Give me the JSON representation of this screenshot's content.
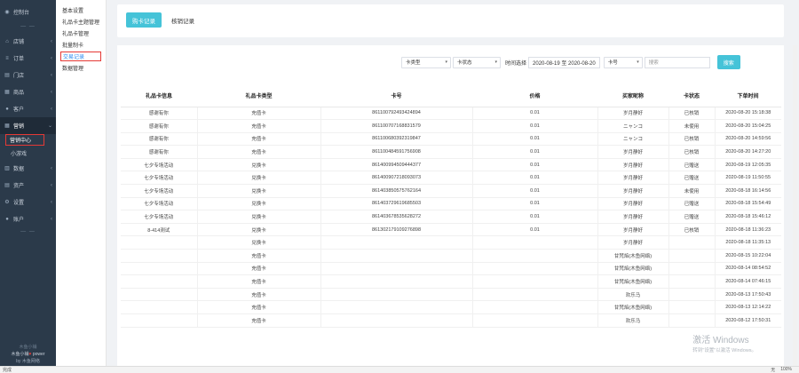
{
  "sidebar": {
    "items": [
      {
        "label": "控制台",
        "icon": "dashboard-icon",
        "glyph": "◉",
        "arrow": ""
      },
      {
        "label": "店铺",
        "icon": "home-icon",
        "glyph": "⌂",
        "arrow": "‹"
      },
      {
        "label": "订单",
        "icon": "list-icon",
        "glyph": "≡",
        "arrow": "‹"
      },
      {
        "label": "门店",
        "icon": "store-icon",
        "glyph": "▤",
        "arrow": "‹"
      },
      {
        "label": "商品",
        "icon": "box-icon",
        "glyph": "▦",
        "arrow": "‹"
      },
      {
        "label": "客户",
        "icon": "user-icon",
        "glyph": "●",
        "arrow": "‹"
      },
      {
        "label": "营销",
        "icon": "marketing-icon",
        "glyph": "▦",
        "arrow": "⌄"
      }
    ],
    "sub_items": [
      {
        "label": "营销中心"
      },
      {
        "label": "小游戏"
      }
    ],
    "items_after": [
      {
        "label": "数据",
        "icon": "chart-icon",
        "glyph": "▥",
        "arrow": "‹"
      },
      {
        "label": "资产",
        "icon": "asset-icon",
        "glyph": "▤",
        "arrow": "‹"
      },
      {
        "label": "设置",
        "icon": "gear-icon",
        "glyph": "⚙",
        "arrow": "‹"
      },
      {
        "label": "账户",
        "icon": "account-icon",
        "glyph": "●",
        "arrow": "‹"
      }
    ],
    "dash": "— —",
    "footer_logo": "木鱼小铺",
    "footer_power_prefix": "木鱼小铺",
    "footer_power_suffix": "power",
    "footer_by": "by 木鱼网络"
  },
  "subnav": {
    "items": [
      "基本设置",
      "礼品卡主题管理",
      "礼品卡管理",
      "批量制卡",
      "交易记录",
      "数据管理"
    ],
    "active_index": 4
  },
  "tabs": {
    "primary": "购卡记录",
    "secondary": "核销记录"
  },
  "filters": {
    "card_type": "卡类型",
    "card_status": "卡状态",
    "time_label": "时间选择",
    "date_range": "2020-08-19 至 2020-08-20",
    "field": "卡号",
    "search_placeholder": "搜索",
    "search_button": "搜索"
  },
  "table": {
    "headers": [
      "礼品卡信息",
      "礼品卡类型",
      "卡号",
      "价格",
      "买家昵称",
      "卡状态",
      "下单时间"
    ],
    "rows": [
      [
        "感谢有你",
        "充值卡",
        "861100792493424894",
        "0.01",
        "岁月静好",
        "已核销",
        "2020-08-20 15:18:38"
      ],
      [
        "感谢有你",
        "充值卡",
        "861100707168831579",
        "0.01",
        "ニャンコ",
        "未使用",
        "2020-08-20 15:04:25"
      ],
      [
        "感谢有你",
        "充值卡",
        "861100680392319847",
        "0.01",
        "ニャンコ",
        "已核销",
        "2020-08-20 14:59:56"
      ],
      [
        "感谢有你",
        "充值卡",
        "861100484591756908",
        "0.01",
        "岁月静好",
        "已核销",
        "2020-08-20 14:27:20"
      ],
      [
        "七夕专场活动",
        "兑换卡",
        "861400994509444377",
        "0.01",
        "岁月静好",
        "已赠送",
        "2020-08-19 12:05:35"
      ],
      [
        "七夕专场活动",
        "兑换卡",
        "861400907218093073",
        "0.01",
        "岁月静好",
        "已赠送",
        "2020-08-19 11:50:55"
      ],
      [
        "七夕专场活动",
        "兑换卡",
        "861403850575762164",
        "0.01",
        "岁月静好",
        "未使用",
        "2020-08-18 16:14:56"
      ],
      [
        "七夕专场活动",
        "兑换卡",
        "861403729619685503",
        "0.01",
        "岁月静好",
        "已赠送",
        "2020-08-18 15:54:49"
      ],
      [
        "七夕专场活动",
        "兑换卡",
        "861403678535628272",
        "0.01",
        "岁月静好",
        "已赠送",
        "2020-08-18 15:46:12"
      ],
      [
        "8-414测试",
        "兑换卡",
        "861302179109276898",
        "0.01",
        "岁月静好",
        "已核销",
        "2020-08-18 11:36:23"
      ],
      [
        "",
        "兑换卡",
        "",
        "",
        "岁月静好",
        "",
        "2020-08-18 11:35:13"
      ],
      [
        "",
        "充值卡",
        "",
        "",
        "甘梵焰(木鱼网络)",
        "",
        "2020-08-15 10:22:04"
      ],
      [
        "",
        "充值卡",
        "",
        "",
        "甘梵焰(木鱼网络)",
        "",
        "2020-08-14 08:54:52"
      ],
      [
        "",
        "充值卡",
        "",
        "",
        "甘梵焰(木鱼网络)",
        "",
        "2020-08-14 07:46:15"
      ],
      [
        "",
        "充值卡",
        "",
        "",
        "欢乐马",
        "",
        "2020-08-13 17:50:43"
      ],
      [
        "",
        "充值卡",
        "",
        "",
        "甘梵焰(木鱼网络)",
        "",
        "2020-08-13 12:14:22"
      ],
      [
        "",
        "充值卡",
        "",
        "",
        "欢乐马",
        "",
        "2020-08-12 17:50:31"
      ]
    ]
  },
  "watermark": {
    "title": "激活 Windows",
    "subtitle": "转到\"设置\"以激活 Windows。"
  },
  "taskbar": {
    "left": "完成",
    "right_items": [
      "无",
      "100%"
    ]
  }
}
